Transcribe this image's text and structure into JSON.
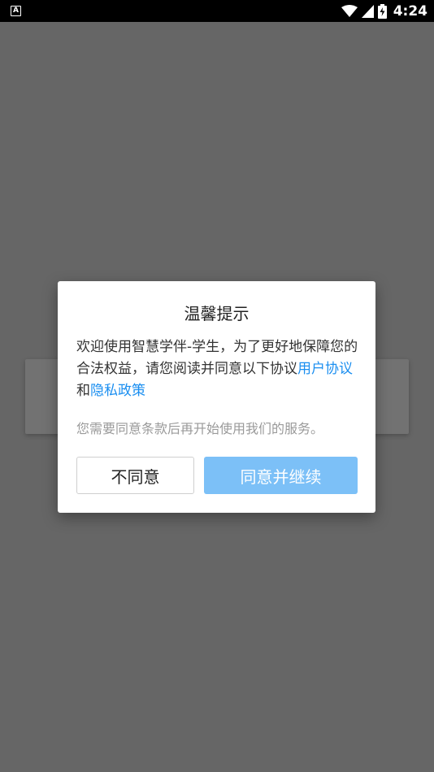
{
  "status_bar": {
    "app_badge": "A",
    "time": "4:24",
    "icons": [
      "wifi-icon",
      "cell-signal-icon",
      "battery-charging-icon"
    ]
  },
  "dialog": {
    "title": "温馨提示",
    "body": {
      "intro": "欢迎使用智慧学伴-学生，为了更好地保障您的合法权益，请您阅读并同意以下协议",
      "user_agreement_link": "用户协议",
      "conjunction": "和",
      "privacy_policy_link": "隐私政策"
    },
    "note": "您需要同意条款后再开始使用我们的服务。",
    "disagree_label": "不同意",
    "agree_label": "同意并继续"
  },
  "colors": {
    "overlay": "#666666",
    "link": "#1a8ef0",
    "agree_button": "#7cc0f7"
  }
}
